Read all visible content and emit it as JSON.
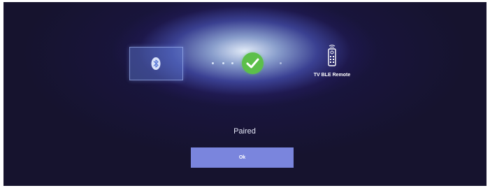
{
  "pairing": {
    "source_icon": "bluetooth-icon",
    "progress_dots": 4,
    "status_icon": "checkmark-icon",
    "target_icon": "remote-control-icon",
    "target_device_name": "TV BLE Remote"
  },
  "status": {
    "text": "Paired"
  },
  "actions": {
    "ok_label": "Ok"
  },
  "colors": {
    "background": "#16132e",
    "glow": "#dbe8ff",
    "source_box": "#5f7dd7",
    "success": "#5cbf4a",
    "button": "#7a85dd",
    "text": "#ffffff"
  }
}
